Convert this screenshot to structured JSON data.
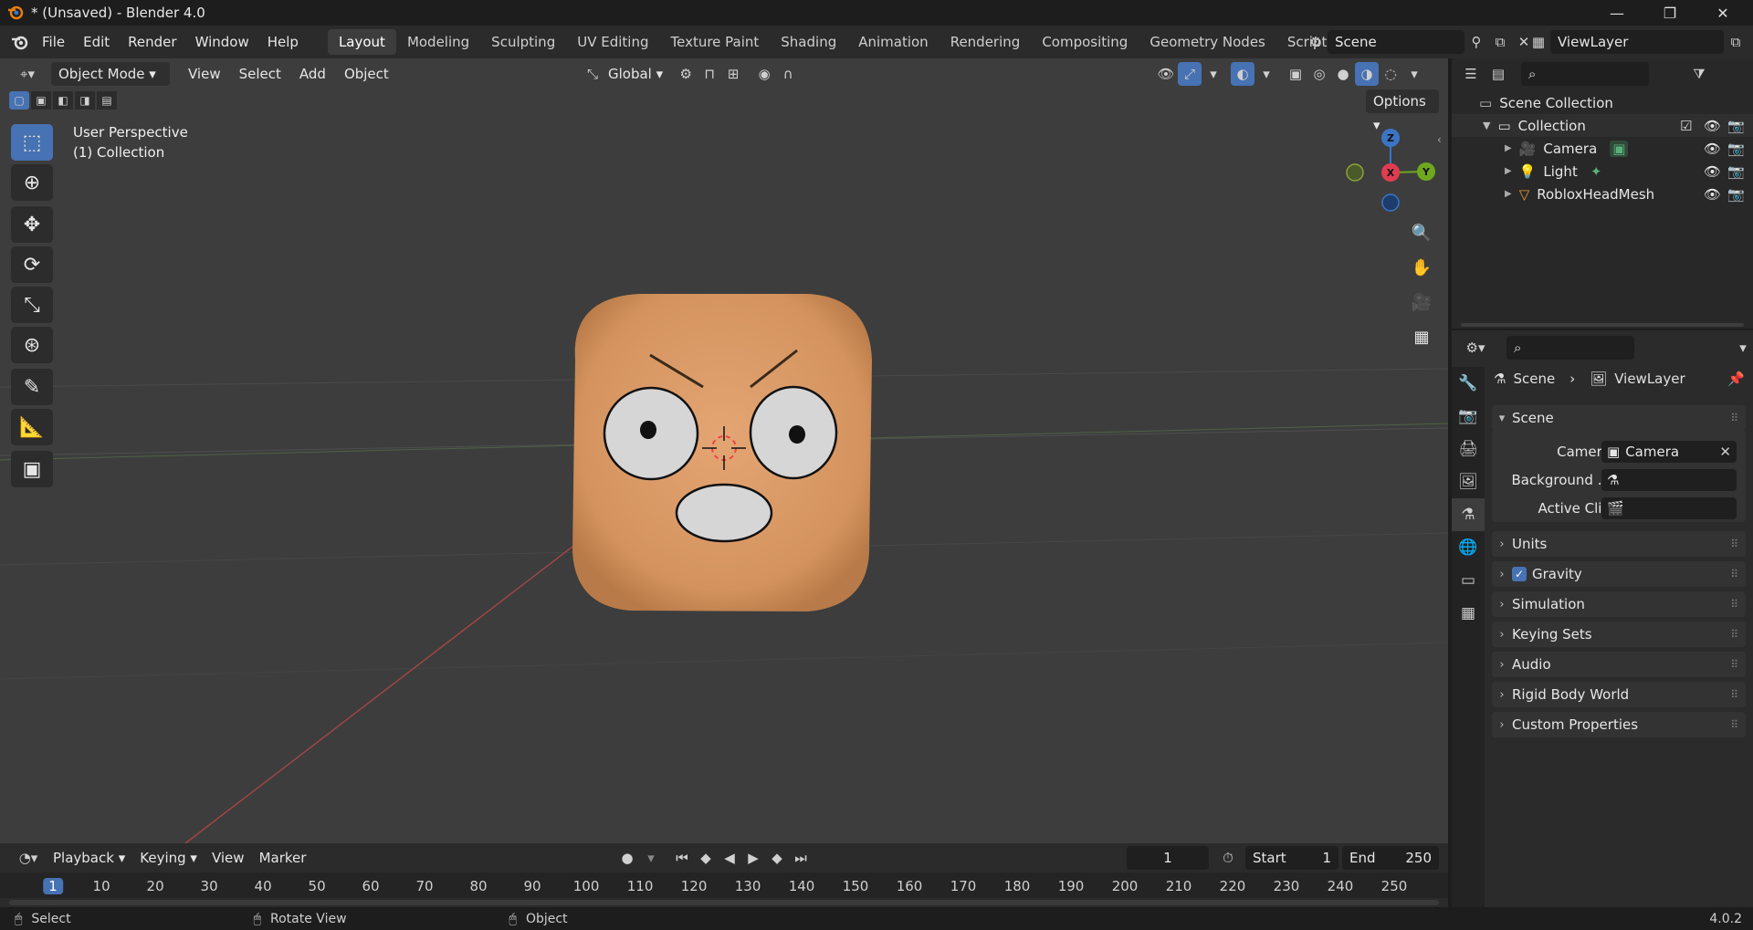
{
  "window": {
    "title": "* (Unsaved) - Blender 4.0",
    "minimize": "—",
    "maximize": "❐",
    "close": "✕"
  },
  "menu": {
    "items": [
      "File",
      "Edit",
      "Render",
      "Window",
      "Help"
    ],
    "workspaces": [
      "Layout",
      "Modeling",
      "Sculpting",
      "UV Editing",
      "Texture Paint",
      "Shading",
      "Animation",
      "Rendering",
      "Compositing",
      "Geometry Nodes",
      "Scripting"
    ],
    "add_workspace": "+",
    "scene_name": "Scene",
    "view_layer_name": "ViewLayer"
  },
  "viewport": {
    "mode": "Object Mode",
    "menus": [
      "View",
      "Select",
      "Add",
      "Object"
    ],
    "transform_orientation": "Global",
    "options_label": "Options",
    "overlay_line1": "User Perspective",
    "overlay_line2": "(1) Collection",
    "gizmo": {
      "z": "Z",
      "x": "X",
      "y": "Y"
    }
  },
  "timeline": {
    "menus": [
      "Playback",
      "Keying",
      "View",
      "Marker"
    ],
    "current_frame": "1",
    "start_label": "Start",
    "start_value": "1",
    "end_label": "End",
    "end_value": "250",
    "ticks": [
      "1",
      "10",
      "20",
      "30",
      "40",
      "50",
      "60",
      "70",
      "80",
      "90",
      "100",
      "110",
      "120",
      "130",
      "140",
      "150",
      "160",
      "170",
      "180",
      "190",
      "200",
      "210",
      "220",
      "230",
      "240",
      "250"
    ]
  },
  "statusbar": {
    "select": "Select",
    "rotate": "Rotate View",
    "object": "Object",
    "version": "4.0.2"
  },
  "outliner": {
    "root": "Scene Collection",
    "collection": "Collection",
    "items": [
      "Camera",
      "Light",
      "RobloxHeadMesh"
    ]
  },
  "properties": {
    "breadcrumb_scene": "Scene",
    "breadcrumb_layer": "ViewLayer",
    "scene_panel": "Scene",
    "camera_label": "Camera",
    "camera_value": "Camera",
    "background_label": "Background ...",
    "active_clip_label": "Active Clip",
    "panels": [
      "Units",
      "Gravity",
      "Simulation",
      "Keying Sets",
      "Audio",
      "Rigid Body World",
      "Custom Properties"
    ]
  },
  "colors": {
    "accent": "#4772b3",
    "viewport_bg": "#3d3d3d",
    "head_skin": "#d99a68"
  }
}
